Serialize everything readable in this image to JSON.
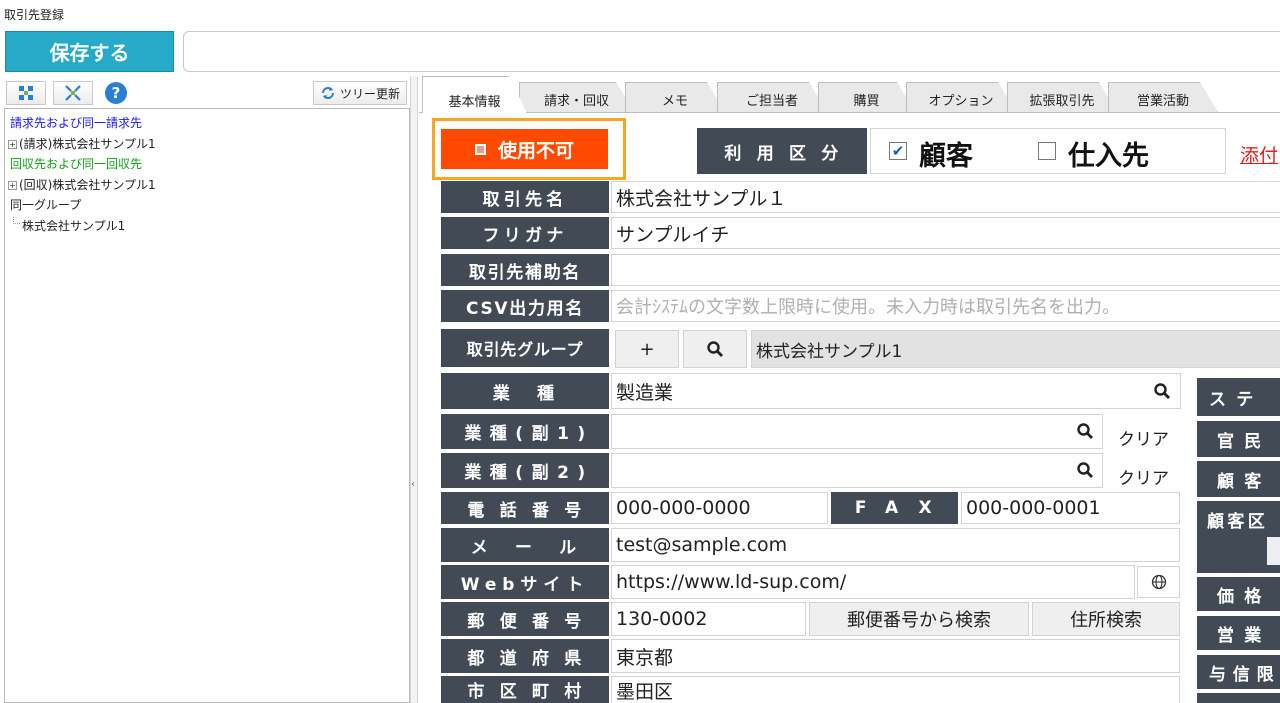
{
  "window": {
    "title": "取引先登録"
  },
  "toolbar": {
    "save_label": "保存する"
  },
  "tree": {
    "refresh_label": "ツリー更新",
    "help_symbol": "?",
    "lines": [
      {
        "text": "請求先および同一請求先"
      },
      {
        "text": "(請求)株式会社サンプル1"
      },
      {
        "text": "回収先および同一回収先"
      },
      {
        "text": "(回収)株式会社サンプル1"
      },
      {
        "text": "同一グループ"
      },
      {
        "text": "株式会社サンプル1"
      }
    ],
    "colors": {
      "billing": "#1a1ae6",
      "collection": "#14a014"
    }
  },
  "tabs": [
    {
      "label": "基本情報"
    },
    {
      "label": "請求・回収"
    },
    {
      "label": "メモ"
    },
    {
      "label": "ご担当者"
    },
    {
      "label": "購買"
    },
    {
      "label": "オプション"
    },
    {
      "label": "拡張取引先"
    },
    {
      "label": "営業活動"
    }
  ],
  "status": {
    "label": "使用不可",
    "color": "#ff4a00",
    "highlight": "#f5a623"
  },
  "usage": {
    "label": "利用区分",
    "customer": {
      "label": "顧客",
      "checked": true,
      "mark": "✔"
    },
    "supplier": {
      "label": "仕入先",
      "checked": false
    }
  },
  "attach_label": "添付",
  "form": {
    "name": {
      "label": "取引先名",
      "value": "株式会社サンプル１"
    },
    "furigana": {
      "label": "フリガナ",
      "value": "サンプルイチ"
    },
    "sub_name": {
      "label": "取引先補助名",
      "value": ""
    },
    "csv_name": {
      "label": "CSV出力用名",
      "placeholder": "会計ｼｽﾃﾑの文字数上限時に使用。未入力時は取引先名を出力。"
    },
    "group": {
      "label": "取引先グループ",
      "add": "+",
      "value": "株式会社サンプル1"
    },
    "industry": {
      "label": "業種",
      "value": "製造業"
    },
    "industry_sub1": {
      "label": "業種(副1)",
      "value": "",
      "clear": "クリア"
    },
    "industry_sub2": {
      "label": "業種(副2)",
      "value": "",
      "clear": "クリア"
    },
    "phone": {
      "label": "電話番号",
      "value": "000-000-0000"
    },
    "fax": {
      "label": "FAX",
      "value": "000-000-0001"
    },
    "email": {
      "label": "メール",
      "value": "test@sample.com"
    },
    "website": {
      "label": "Webサイト",
      "value": "https://www.ld-sup.com/"
    },
    "postal": {
      "label": "郵便番号",
      "value": "130-0002",
      "search_by_postal": "郵便番号から検索",
      "address_search": "住所検索"
    },
    "prefecture": {
      "label": "都道府県",
      "value": "東京都"
    },
    "city": {
      "label": "市区町村",
      "value": "墨田区"
    }
  },
  "right_labels": [
    {
      "label": "ステ"
    },
    {
      "label": "官民"
    },
    {
      "label": "顧客"
    },
    {
      "label": "顧客区"
    },
    {
      "label": "価格"
    },
    {
      "label": "営業"
    },
    {
      "label": "与信限"
    }
  ]
}
